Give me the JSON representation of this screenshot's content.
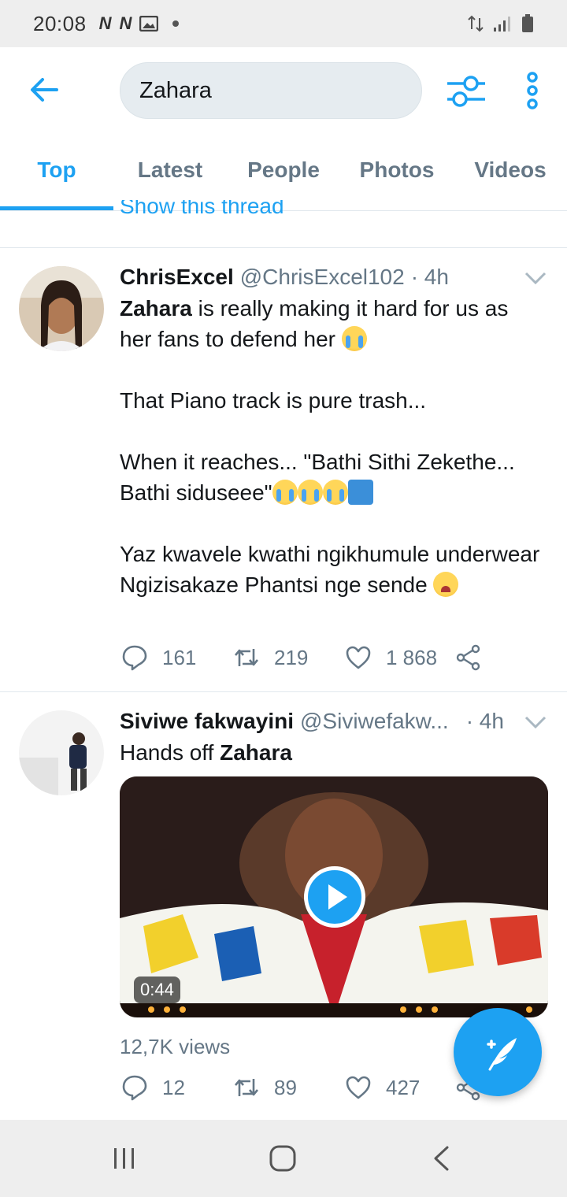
{
  "status_bar": {
    "time": "20:08",
    "notif_icons": [
      "N",
      "N"
    ]
  },
  "search": {
    "query": "Zahara"
  },
  "tabs": [
    {
      "label": "Top",
      "active": true
    },
    {
      "label": "Latest",
      "active": false
    },
    {
      "label": "People",
      "active": false
    },
    {
      "label": "Photos",
      "active": false
    },
    {
      "label": "Videos",
      "active": false
    }
  ],
  "show_thread": "Show this thread",
  "tweets": [
    {
      "name": "ChrisExcel",
      "handle": "@ChrisExcel102",
      "time": "· 4h",
      "text_line1_bold": "Zahara",
      "text_line1_rest": " is really making it hard for us as her fans  to defend her",
      "text_p2": "That Piano track is pure trash...",
      "text_p3": "When it reaches... \"Bathi Sithi Zekethe... Bathi siduseee\"",
      "text_p4": "Yaz kwavele kwathi ngikhumule underwear Ngizisakaze Phantsi nge sende",
      "replies": "161",
      "retweets": "219",
      "likes": "1 868"
    },
    {
      "name": "Siviwe fakwayini",
      "handle": "@Siviwefakw...",
      "time": "· 4h",
      "text_prefix": "Hands off ",
      "text_bold": "Zahara",
      "video_duration": "0:44",
      "views": "12,7K views",
      "replies": "12",
      "retweets": "89",
      "likes": "427"
    }
  ],
  "colors": {
    "accent": "#1da1f2",
    "secondary_text": "#657786"
  }
}
